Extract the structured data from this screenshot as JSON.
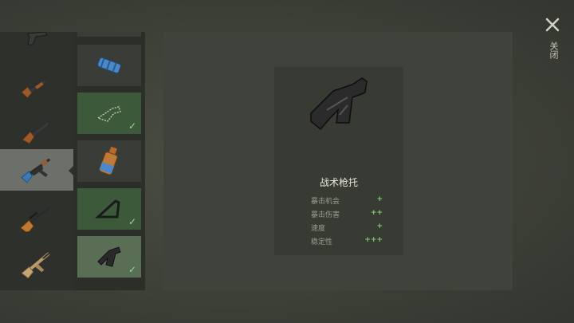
{
  "close_label": "关闭",
  "weapons": [
    {
      "icon": "pistol-icon"
    },
    {
      "icon": "shotgun-icon"
    },
    {
      "icon": "sawed-off-shotgun-icon"
    },
    {
      "icon": "ak47-rifle-icon",
      "selected": true
    },
    {
      "icon": "sniper-rifle-icon"
    },
    {
      "icon": "tan-assault-rifle-icon"
    }
  ],
  "attachments": [
    {
      "icon": "suppressor-icon",
      "equipped": false
    },
    {
      "icon": "stock-outline-icon",
      "equipped": true
    },
    {
      "icon": "magazine-icon",
      "equipped": false
    },
    {
      "icon": "folding-stock-icon",
      "equipped": true
    },
    {
      "icon": "tactical-stock-icon",
      "equipped": true,
      "selected": true
    }
  ],
  "detail": {
    "name": "战术枪托",
    "icon": "tactical-stock-icon",
    "stats": [
      {
        "label": "暴击机会",
        "value": "+"
      },
      {
        "label": "暴击伤害",
        "value": "++"
      },
      {
        "label": "速度",
        "value": "+"
      },
      {
        "label": "稳定性",
        "value": "+++"
      }
    ]
  },
  "colors": {
    "stat_positive": "#7ed06f",
    "equipped_bg": "#3c5a3a",
    "check": "#8fe08a"
  }
}
